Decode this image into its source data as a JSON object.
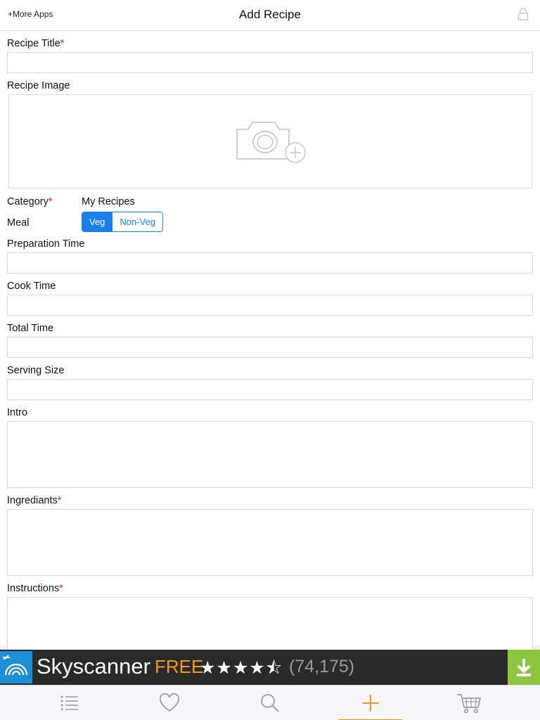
{
  "app": {
    "more_apps": "+More Apps",
    "title": "Add Recipe"
  },
  "form": {
    "recipe_title": "Recipe Title",
    "recipe_image": "Recipe Image",
    "category_label": "Category",
    "category_value": "My Recipes",
    "meal_label": "Meal",
    "meal_options": [
      "Veg",
      "Non-Veg"
    ],
    "meal_selected": "Veg",
    "preparation_time": "Preparation Time",
    "cook_time": "Cook Time",
    "total_time": "Total Time",
    "serving_size": "Serving Size",
    "intro": "Intro",
    "ingredients": "Ingrediants",
    "instructions": "Instructions",
    "required_mark": "*"
  },
  "ad": {
    "name": "Skyscanner",
    "price": "FREE",
    "stars": "★★★★⯪",
    "rating_count": "(74,175)",
    "rating_value": 4.5
  },
  "tabbar": {
    "items": [
      "list-icon",
      "heart-icon",
      "search-icon",
      "plus-icon",
      "cart-icon"
    ],
    "active": "plus-icon"
  },
  "colors": {
    "accent": "#1a7fe8",
    "required": "#e02020",
    "tab_active": "#f28b1c",
    "ad_free": "#f39a1e",
    "ad_download": "#8cc63f"
  }
}
